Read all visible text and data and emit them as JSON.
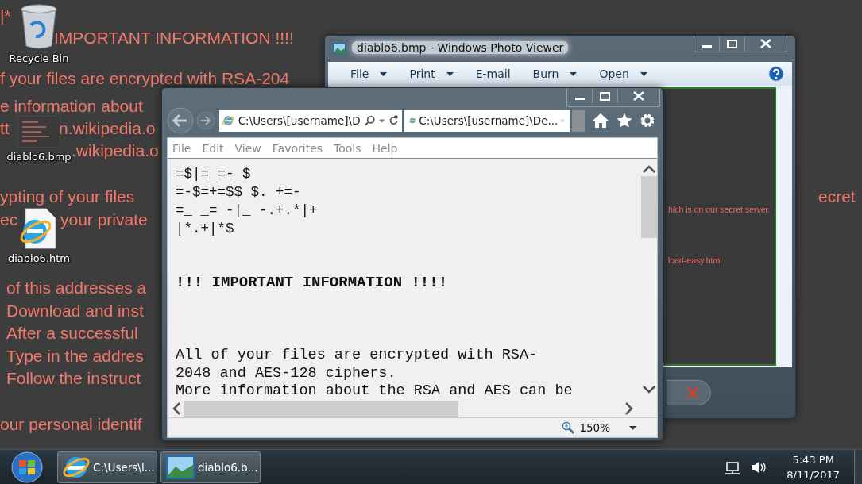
{
  "desktop": {
    "wallpaper_lines": [
      "|*",
      "IMPORTANT INFORMATION !!!!",
      "f your files are encrypted with RSA-204",
      "e information about",
      "tt",
      "n.wikipedia.o",
      ".wikipedia.o",
      "ypting of your files",
      "ec",
      "your private",
      "of this addresses a",
      "Download and inst",
      "After a successful",
      "Type in the addres",
      "Follow the instruct",
      "our personal identif"
    ],
    "wallpaper_right": "ecret",
    "icons": [
      {
        "label": "Recycle Bin",
        "kind": "recycle"
      },
      {
        "label": "diablo6.bmp",
        "kind": "bitmap"
      },
      {
        "label": "diablo6.htm",
        "kind": "webpage"
      }
    ]
  },
  "photo_viewer": {
    "title": "diablo6.bmp - Windows Photo Viewer",
    "menu": [
      {
        "label": "File",
        "dropdown": true
      },
      {
        "label": "Print",
        "dropdown": true
      },
      {
        "label": "E-mail",
        "dropdown": false
      },
      {
        "label": "Burn",
        "dropdown": true
      },
      {
        "label": "Open",
        "dropdown": true
      }
    ],
    "image_lines": [
      "hich is on our secret server.",
      "load-easy.html"
    ]
  },
  "browser": {
    "address": "C:\\Users\\[username]\\D",
    "tab": "C:\\Users\\[username]\\De...",
    "menu": [
      "File",
      "Edit",
      "View",
      "Favorites",
      "Tools",
      "Help"
    ],
    "ascii_lines": [
      "=$|=_=-_$",
      "=-$=+=$$ $. +=-",
      "=_ _= -|_ -.+.*|+",
      "|*.+|*$"
    ],
    "heading": "!!! IMPORTANT INFORMATION !!!!",
    "paragraph_lines": [
      "All of your files are encrypted with RSA-",
      "2048 and AES-128 ciphers.",
      "More information about the RSA and AES can be"
    ],
    "zoom": "150%"
  },
  "taskbar": {
    "buttons": [
      {
        "label": "C:\\Users\\l...",
        "kind": "browser"
      },
      {
        "label": "diablo6.b...",
        "kind": "photo"
      }
    ],
    "time": "5:43 PM",
    "date": "8/11/2017"
  }
}
